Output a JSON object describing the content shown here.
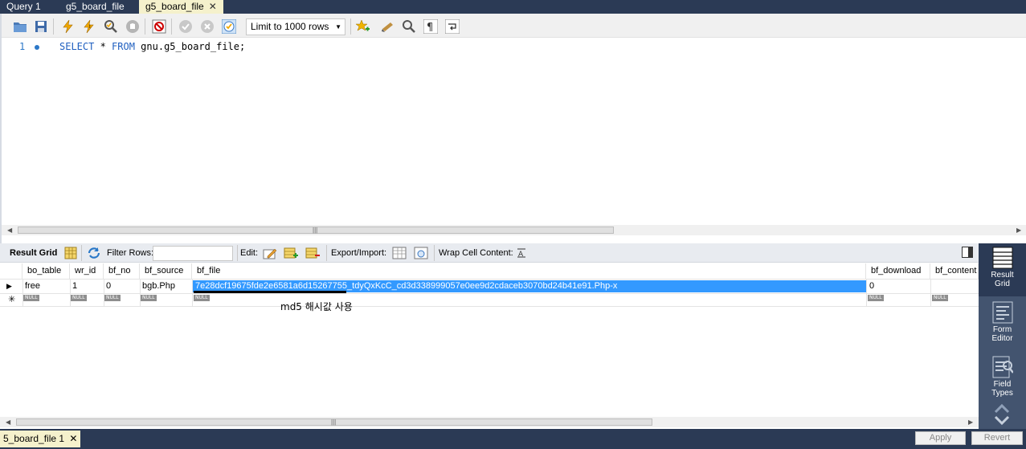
{
  "tabs": [
    {
      "label": "Query 1"
    },
    {
      "label": "g5_board_file"
    },
    {
      "label": "g5_board_file",
      "close": "✕"
    }
  ],
  "toolbar": {
    "limit_label": "Limit to 1000 rows"
  },
  "editor": {
    "line_number": "1",
    "sql_keyword1": "SELECT",
    "sql_star": " * ",
    "sql_keyword2": "FROM",
    "sql_rest": " gnu.g5_board_file;"
  },
  "result_toolbar": {
    "result_grid": "Result Grid",
    "filter_rows": "Filter Rows:",
    "edit": "Edit:",
    "export_import": "Export/Import:",
    "wrap_cell": "Wrap Cell Content:"
  },
  "grid": {
    "columns": [
      "bo_table",
      "wr_id",
      "bf_no",
      "bf_source",
      "bf_file",
      "bf_download",
      "bf_content"
    ],
    "row": {
      "bo_table": "free",
      "wr_id": "1",
      "bf_no": "0",
      "bf_source": "bgb.Php",
      "bf_file": "7e28dcf19675fde2e6581a6d15267755_tdyQxKcC_cd3d338999057e0ee9d2cdaceb3070bd24b41e91.Php-x",
      "bf_download": "0"
    },
    "null_label": "NULL",
    "new_row_marker": "✳",
    "current_row_marker": "▶"
  },
  "annotation": "md5 해시값 사용",
  "sidebar": [
    {
      "label_1": "Result",
      "label_2": "Grid"
    },
    {
      "label_1": "Form",
      "label_2": "Editor"
    },
    {
      "label_1": "Field",
      "label_2": "Types"
    }
  ],
  "bottom": {
    "result_tab": "5_board_file 1",
    "close": "✕",
    "apply": "Apply",
    "revert": "Revert"
  },
  "colors": {
    "chrome_dark": "#2b3a55",
    "active_tab": "#f5f1cc",
    "selection": "#3399ff",
    "sql_keyword": "#2060c0"
  }
}
